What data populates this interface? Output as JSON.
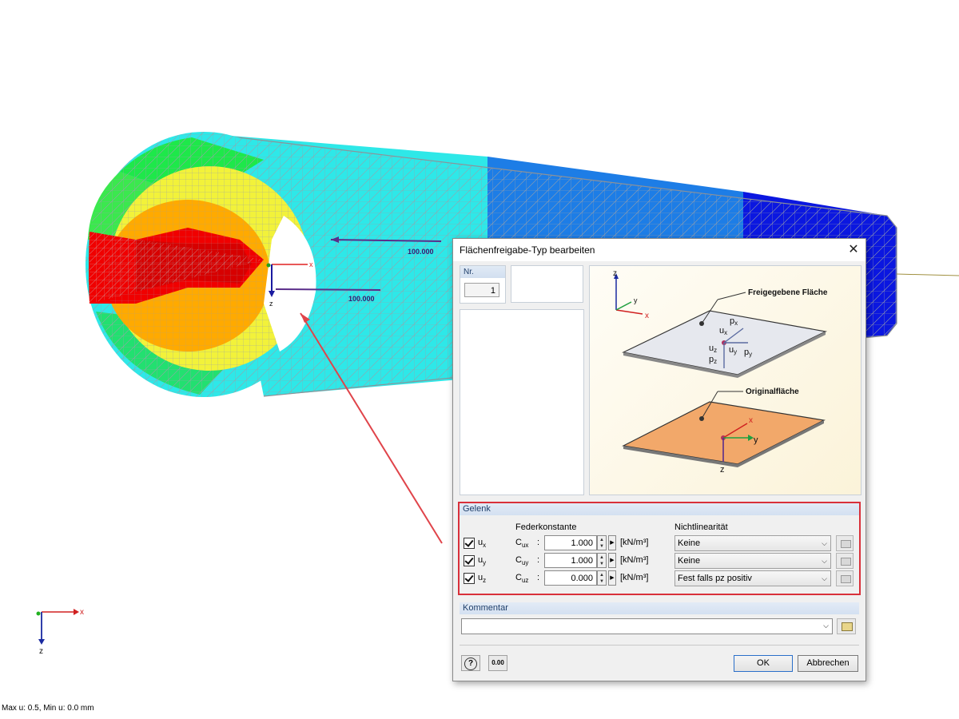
{
  "viewport": {
    "status_text": "Max u: 0.5, Min u: 0.0 mm",
    "dim_label_1": "100.000",
    "dim_label_2": "100.000",
    "axis_x": "x",
    "axis_z": "z",
    "axis_y": "y",
    "local_axis_x": "x",
    "local_axis_z": "z"
  },
  "dialog": {
    "title": "Flächenfreigabe-Typ bearbeiten",
    "close_symbol": "✕",
    "nr_label": "Nr.",
    "nr_value": "1",
    "figure": {
      "label_released": "Freigegebene Fläche",
      "label_original": "Originalfläche",
      "axis_z": "z",
      "axis_y": "y",
      "axis_x": "x",
      "px": "p",
      "px_sub": "x",
      "ux": "u",
      "ux_sub": "x",
      "uz": "u",
      "uz_sub": "z",
      "uy": "u",
      "uy_sub": "y",
      "py": "p",
      "py_sub": "y",
      "pz": "p",
      "pz_sub": "z",
      "orig_x": "x",
      "orig_y": "y",
      "orig_z": "z"
    },
    "gelenk": {
      "title": "Gelenk",
      "col_spring": "Federkonstante",
      "col_nonlin": "Nichtlinearität",
      "rows": [
        {
          "label": "u",
          "sub": "x",
          "c": "C",
          "csub": "ux",
          "value": "1.000",
          "unit": "[kN/m³]",
          "nonlin": "Keine"
        },
        {
          "label": "u",
          "sub": "y",
          "c": "C",
          "csub": "uy",
          "value": "1.000",
          "unit": "[kN/m³]",
          "nonlin": "Keine"
        },
        {
          "label": "u",
          "sub": "z",
          "c": "C",
          "csub": "uz",
          "value": "0.000",
          "unit": "[kN/m³]",
          "nonlin": "Fest falls pz positiv"
        }
      ]
    },
    "kommentar": {
      "title": "Kommentar",
      "value": ""
    },
    "buttons": {
      "ok": "OK",
      "cancel": "Abbrechen",
      "help_symbol": "?",
      "units_symbol": "0.00"
    }
  },
  "colors": {
    "accent_red": "#d9303a",
    "section_blue": "#1f3f6b"
  }
}
